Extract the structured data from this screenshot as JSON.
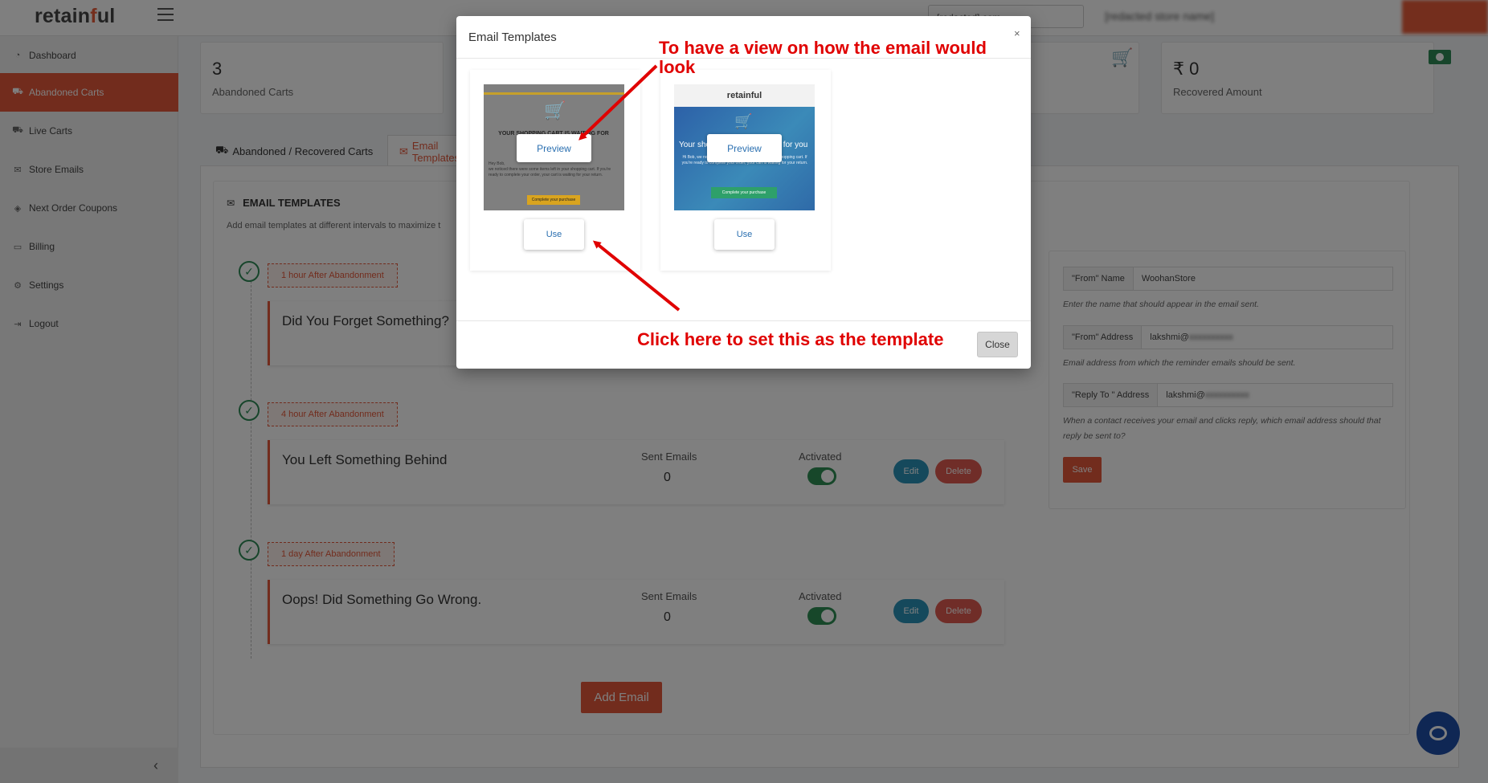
{
  "app": {
    "logo_pre": "retain",
    "logo_accent": "f",
    "logo_post": "ul",
    "brand_color": "#e4583a",
    "top_domain": "[redacted].com",
    "top_store": "[redacted store name]",
    "user_menu": ""
  },
  "sidebar": {
    "items": [
      {
        "label": "Dashboard",
        "icon": "dashboard-icon",
        "active": false
      },
      {
        "label": "Abandoned Carts",
        "icon": "cart-icon",
        "active": true
      },
      {
        "label": "Live Carts",
        "icon": "live-cart-icon",
        "active": false
      },
      {
        "label": "Store Emails",
        "icon": "envelope-icon",
        "active": false
      },
      {
        "label": "Next Order Coupons",
        "icon": "tag-icon",
        "active": false
      },
      {
        "label": "Billing",
        "icon": "billing-icon",
        "active": false
      },
      {
        "label": "Settings",
        "icon": "gear-icon",
        "active": false
      },
      {
        "label": "Logout",
        "icon": "logout-icon",
        "active": false
      }
    ],
    "collapse_glyph": "‹"
  },
  "stats": {
    "abandoned": {
      "value": "3",
      "label": "Abandoned Carts"
    },
    "recovered": {
      "value": "₹ 0",
      "label": "Recovered Amount"
    }
  },
  "tabs": {
    "carts": "Abandoned / Recovered Carts",
    "templates": "Email Templates"
  },
  "templates_section": {
    "title": "EMAIL TEMPLATES",
    "description": "Add email templates at different intervals to maximize t"
  },
  "emails": [
    {
      "interval": "1 hour After Abandonment",
      "title": "Did You Forget Something?"
    },
    {
      "interval": "4 hour After Abandonment",
      "title": "You Left Something Behind",
      "sent_label": "Sent Emails",
      "sent": "0",
      "activated_label": "Activated",
      "edit": "Edit",
      "delete": "Delete"
    },
    {
      "interval": "1 day After Abandonment",
      "title": "Oops! Did Something Go Wrong.",
      "sent_label": "Sent Emails",
      "sent": "0",
      "activated_label": "Activated",
      "edit": "Edit",
      "delete": "Delete"
    }
  ],
  "add_email": "Add Email",
  "settings": {
    "from_name_label": "\"From\" Name",
    "from_name_value": "WoohanStore",
    "from_name_hint": "Enter the name that should appear in the email sent.",
    "from_address_label": "\"From\" Address",
    "from_address_value": "lakshmi@",
    "from_address_hint": "Email address from which the reminder emails should be sent.",
    "reply_to_label": "\"Reply To \" Address",
    "reply_to_value": "lakshmi@",
    "reply_to_hint": "When a contact receives your email and clicks reply, which email address should that reply be sent to?",
    "save": "Save"
  },
  "modal": {
    "title": "Email Templates",
    "close_x": "×",
    "close": "Close",
    "templates": [
      {
        "preview": "Preview",
        "use": "Use",
        "thumb_heading": "YOUR SHOPPING CART IS WAITING FOR YOU",
        "thumb_greeting": "Hey Bob,",
        "thumb_body": "we noticed there were some items left in your shopping cart. If you're ready to complete your order, your cart is waiting for your return.",
        "thumb_cta": "Complete your purchase"
      },
      {
        "preview": "Preview",
        "use": "Use",
        "thumb_brand": "retainful",
        "thumb_heading": "Your shopping cart is waiting for you",
        "thumb_body": "Hi Bob, we noticed there were some items left in your shopping cart. If you're ready to complete your order, your cart is waiting for your return.",
        "thumb_cta": "Complete your purchase"
      }
    ]
  },
  "annotations": {
    "preview_note": "To have a view on how the email would look",
    "use_note": "Click here to set this as the template",
    "color": "#e00000"
  }
}
